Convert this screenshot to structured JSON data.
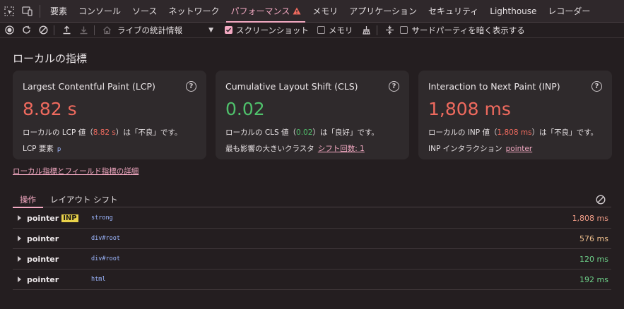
{
  "tabs": [
    {
      "label": "要素"
    },
    {
      "label": "コンソール"
    },
    {
      "label": "ソース"
    },
    {
      "label": "ネットワーク"
    },
    {
      "label": "パフォーマンス",
      "active": true,
      "warning": true
    },
    {
      "label": "メモリ"
    },
    {
      "label": "アプリケーション"
    },
    {
      "label": "セキュリティ"
    },
    {
      "label": "Lighthouse"
    },
    {
      "label": "レコーダー"
    }
  ],
  "toolbar": {
    "dropdown_value": "ライブの統計情報",
    "screenshot_label": "スクリーンショット",
    "screenshot_checked": true,
    "memory_label": "メモリ",
    "memory_checked": false,
    "thirdparty_label": "サードパーティを暗く表示する",
    "thirdparty_checked": false
  },
  "main": {
    "heading": "ローカルの指標",
    "help_glyph": "?",
    "cards": [
      {
        "title": "Largest Contentful Paint (LCP)",
        "value": "8.82 s",
        "status": "bad",
        "desc_prefix": "ローカルの LCP 値（",
        "desc_value": "8.82 s",
        "desc_suffix": "）は「不良」です。",
        "sub_label": "LCP 要素",
        "sub_value": "p"
      },
      {
        "title": "Cumulative Layout Shift (CLS)",
        "value": "0.02",
        "status": "good",
        "desc_prefix": "ローカルの CLS 値（",
        "desc_value": "0.02",
        "desc_suffix": "）は「良好」です。",
        "sub_label": "最も影響の大きいクラスタ",
        "sub_value": "シフト回数: 1"
      },
      {
        "title": "Interaction to Next Paint (INP)",
        "value": "1,808 ms",
        "status": "bad",
        "desc_prefix": "ローカルの INP 値（",
        "desc_value": "1,808 ms",
        "desc_suffix": "）は「不良」です。",
        "sub_label": "INP インタラクション",
        "sub_value": "pointer"
      }
    ],
    "details_link": "ローカル指標とフィールド指標の詳細",
    "subtabs": [
      {
        "label": "操作",
        "active": true
      },
      {
        "label": "レイアウト シフト"
      }
    ],
    "interactions": [
      {
        "name": "pointer",
        "tag": "INP",
        "node": "strong",
        "duration": "1,808 ms",
        "status": "bad"
      },
      {
        "name": "pointer",
        "tag": "",
        "node": "div#root",
        "duration": "576 ms",
        "status": "warn"
      },
      {
        "name": "pointer",
        "tag": "",
        "node": "div#root",
        "duration": "120 ms",
        "status": "good"
      },
      {
        "name": "pointer",
        "tag": "",
        "node": "html",
        "duration": "192 ms",
        "status": "good"
      }
    ]
  },
  "colors": {
    "accent": "#f3a9c2",
    "bad": "#ef6a5e",
    "good": "#4fc06b",
    "warning_icon": "#ef6a5e"
  }
}
